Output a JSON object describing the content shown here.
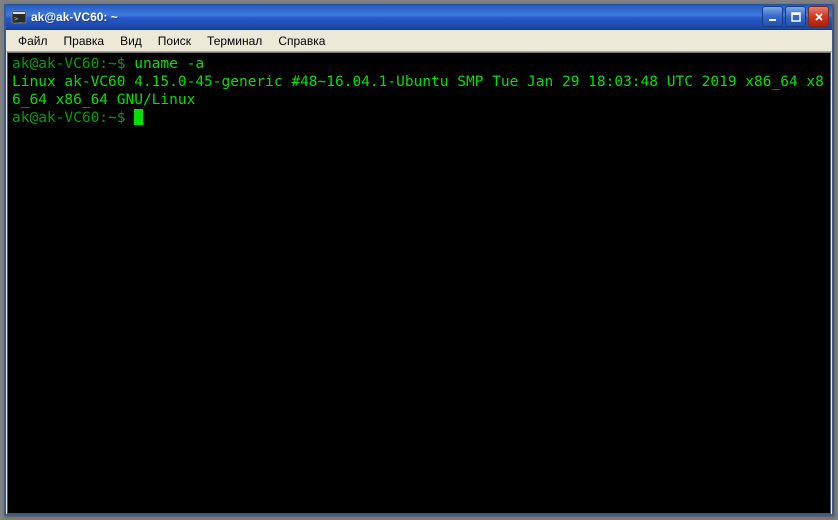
{
  "window": {
    "title": "ak@ak-VC60: ~"
  },
  "menu": {
    "items": [
      "Файл",
      "Правка",
      "Вид",
      "Поиск",
      "Терминал",
      "Справка"
    ]
  },
  "terminal": {
    "prompt1": "ak@ak-VC60:~$ ",
    "command1": "uname -a",
    "output": "Linux ak-VC60 4.15.0-45-generic #48~16.04.1-Ubuntu SMP Tue Jan 29 18:03:48 UTC 2019 x86_64 x86_64 x86_64 GNU/Linux",
    "prompt2": "ak@ak-VC60:~$ "
  }
}
